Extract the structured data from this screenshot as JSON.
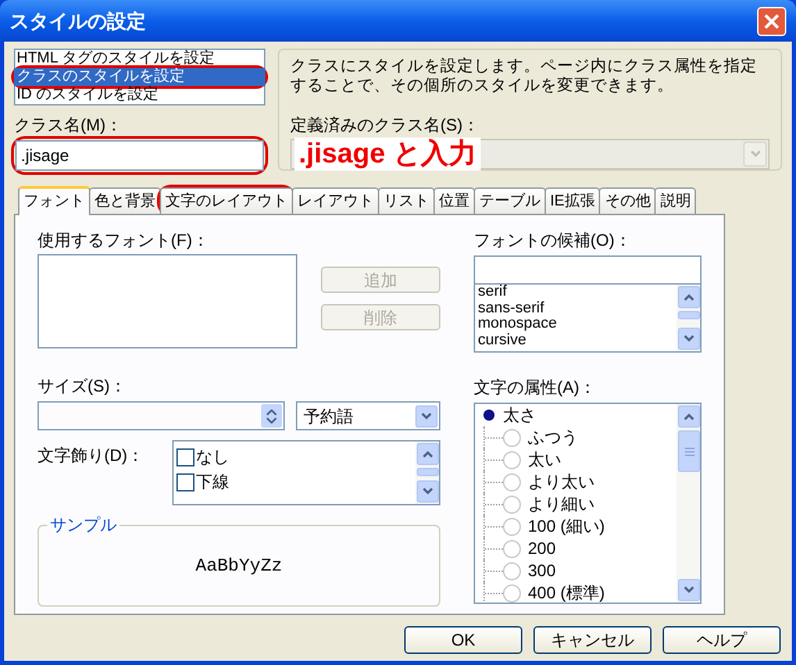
{
  "window": {
    "title": "スタイルの設定"
  },
  "style_targets": [
    {
      "label": "HTML タグのスタイルを設定",
      "selected": false,
      "highlighted": false
    },
    {
      "label": "クラスのスタイルを設定",
      "selected": true,
      "highlighted": true
    },
    {
      "label": "ID のスタイルを設定",
      "selected": false,
      "highlighted": false
    }
  ],
  "class_name": {
    "label": "クラス名(M)：",
    "value": ".jisage",
    "highlighted": true
  },
  "description": "クラスにスタイルを設定します。ページ内にクラス属性を指定することで、その個所のスタイルを変更できます。",
  "defined_classes": {
    "label": "定義済みのクラス名(S)：",
    "disabled": true
  },
  "callout": {
    "text": ".jisage と入力"
  },
  "tabs": [
    {
      "label": "フォント",
      "selected": true,
      "highlighted": false
    },
    {
      "label": "色と背景",
      "selected": false,
      "highlighted": false
    },
    {
      "label": "文字のレイアウト",
      "selected": false,
      "highlighted": true
    },
    {
      "label": "レイアウト",
      "selected": false,
      "highlighted": false
    },
    {
      "label": "リスト",
      "selected": false,
      "highlighted": false
    },
    {
      "label": "位置",
      "selected": false,
      "highlighted": false
    },
    {
      "label": "テーブル",
      "selected": false,
      "highlighted": false
    },
    {
      "label": "IE拡張",
      "selected": false,
      "highlighted": false
    },
    {
      "label": "その他",
      "selected": false,
      "highlighted": false
    },
    {
      "label": "説明",
      "selected": false,
      "highlighted": false
    }
  ],
  "font_tab": {
    "used_fonts": {
      "label": "使用するフォント(F)："
    },
    "font_buttons": [
      {
        "label": "追加",
        "disabled": true
      },
      {
        "label": "削除",
        "disabled": true
      }
    ],
    "candidates": {
      "label": "フォントの候補(O)：",
      "items": [
        "serif",
        "sans-serif",
        "monospace",
        "cursive"
      ]
    },
    "size": {
      "label": "サイズ(S)：",
      "unit": "予約語"
    },
    "decoration": {
      "label": "文字飾り(D)：",
      "items": [
        {
          "label": "なし",
          "checked": false
        },
        {
          "label": "下線",
          "checked": false
        }
      ]
    },
    "attributes": {
      "label": "文字の属性(A)：",
      "group": "太さ",
      "options": [
        {
          "label": "ふつう",
          "selected": false
        },
        {
          "label": "太い",
          "selected": false
        },
        {
          "label": "より太い",
          "selected": false
        },
        {
          "label": "より細い",
          "selected": false
        },
        {
          "label": "100 (細い)",
          "selected": false
        },
        {
          "label": "200",
          "selected": false
        },
        {
          "label": "300",
          "selected": false
        },
        {
          "label": "400 (標準)",
          "selected": false
        }
      ]
    },
    "sample": {
      "label": "サンプル",
      "text": "AaBbYyZz"
    }
  },
  "buttons": [
    "OK",
    "キャンセル",
    "ヘルプ"
  ]
}
